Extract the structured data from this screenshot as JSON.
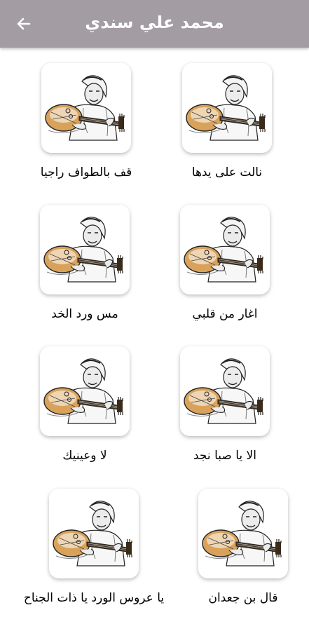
{
  "header": {
    "title": "محمد علي سندي",
    "back_icon": "arrow-left-icon"
  },
  "colors": {
    "appbar": "#a39ca3",
    "title": "#ffffff",
    "oud_wood": "#d9a25a"
  },
  "songs": [
    {
      "title": "نالت على يدها"
    },
    {
      "title": "قف بالطواف راجيا"
    },
    {
      "title": "اغار من قلبي"
    },
    {
      "title": "مس ورد الخد"
    },
    {
      "title": "الا يا صبا نجد"
    },
    {
      "title": "لا وعينيك"
    },
    {
      "title": "قال بن جعدان"
    },
    {
      "title": "يا عروس الورد يا ذات الجناح"
    }
  ]
}
